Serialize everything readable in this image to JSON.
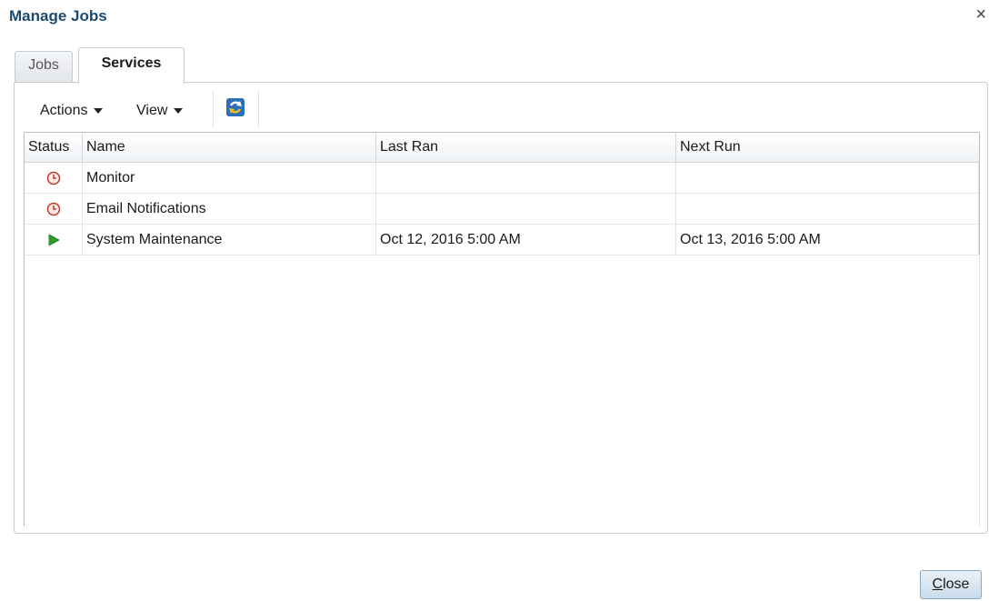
{
  "dialog": {
    "title": "Manage Jobs",
    "close_glyph": "×"
  },
  "tabs": [
    {
      "label": "Jobs",
      "active": false
    },
    {
      "label": "Services",
      "active": true
    }
  ],
  "toolbar": {
    "actions_label": "Actions",
    "view_label": "View",
    "refresh_icon": "refresh-icon"
  },
  "grid": {
    "columns": [
      "Status",
      "Name",
      "Last Ran",
      "Next Run"
    ],
    "rows": [
      {
        "status": "scheduled",
        "status_icon": "clock-icon",
        "name": "Monitor",
        "last_ran": "",
        "next_run": ""
      },
      {
        "status": "scheduled",
        "status_icon": "clock-icon",
        "name": "Email Notifications",
        "last_ran": "",
        "next_run": ""
      },
      {
        "status": "running",
        "status_icon": "play-icon",
        "name": "System Maintenance",
        "last_ran": "Oct 12, 2016 5:00 AM",
        "next_run": "Oct 13, 2016 5:00 AM"
      }
    ]
  },
  "footer": {
    "close_first": "C",
    "close_rest": "lose"
  },
  "colors": {
    "title": "#1d4a6c",
    "clock": "#c0392b",
    "play": "#2e9e2e",
    "button": "#c9dbea"
  }
}
